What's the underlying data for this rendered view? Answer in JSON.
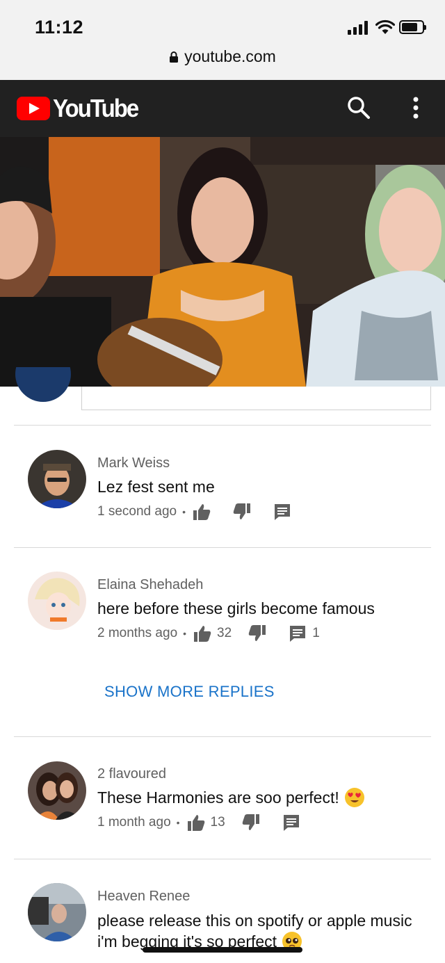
{
  "status": {
    "time": "11:12",
    "url": "youtube.com"
  },
  "header": {
    "logo_text": "YouTube",
    "brand_color": "#ff0000",
    "bar_color": "#212121"
  },
  "comments": [
    {
      "author": "Mark Weiss",
      "text": "Lez fest sent me",
      "age": "1 second ago",
      "likes": "",
      "replies": ""
    },
    {
      "author": "Elaina Shehadeh",
      "text": "here before these girls become famous",
      "age": "2 months ago",
      "likes": "32",
      "replies": "1"
    },
    {
      "author": "2 flavoured",
      "text": "These Harmonies are soo perfect!",
      "age": "1 month ago",
      "likes": "13",
      "replies": ""
    },
    {
      "author": "Heaven Renee",
      "text": "please release this on spotify or apple music i'm begging it's so perfect",
      "age": "",
      "likes": "",
      "replies": ""
    }
  ],
  "show_more_label": "SHOW MORE REPLIES",
  "accent_color": "#1a73c9"
}
